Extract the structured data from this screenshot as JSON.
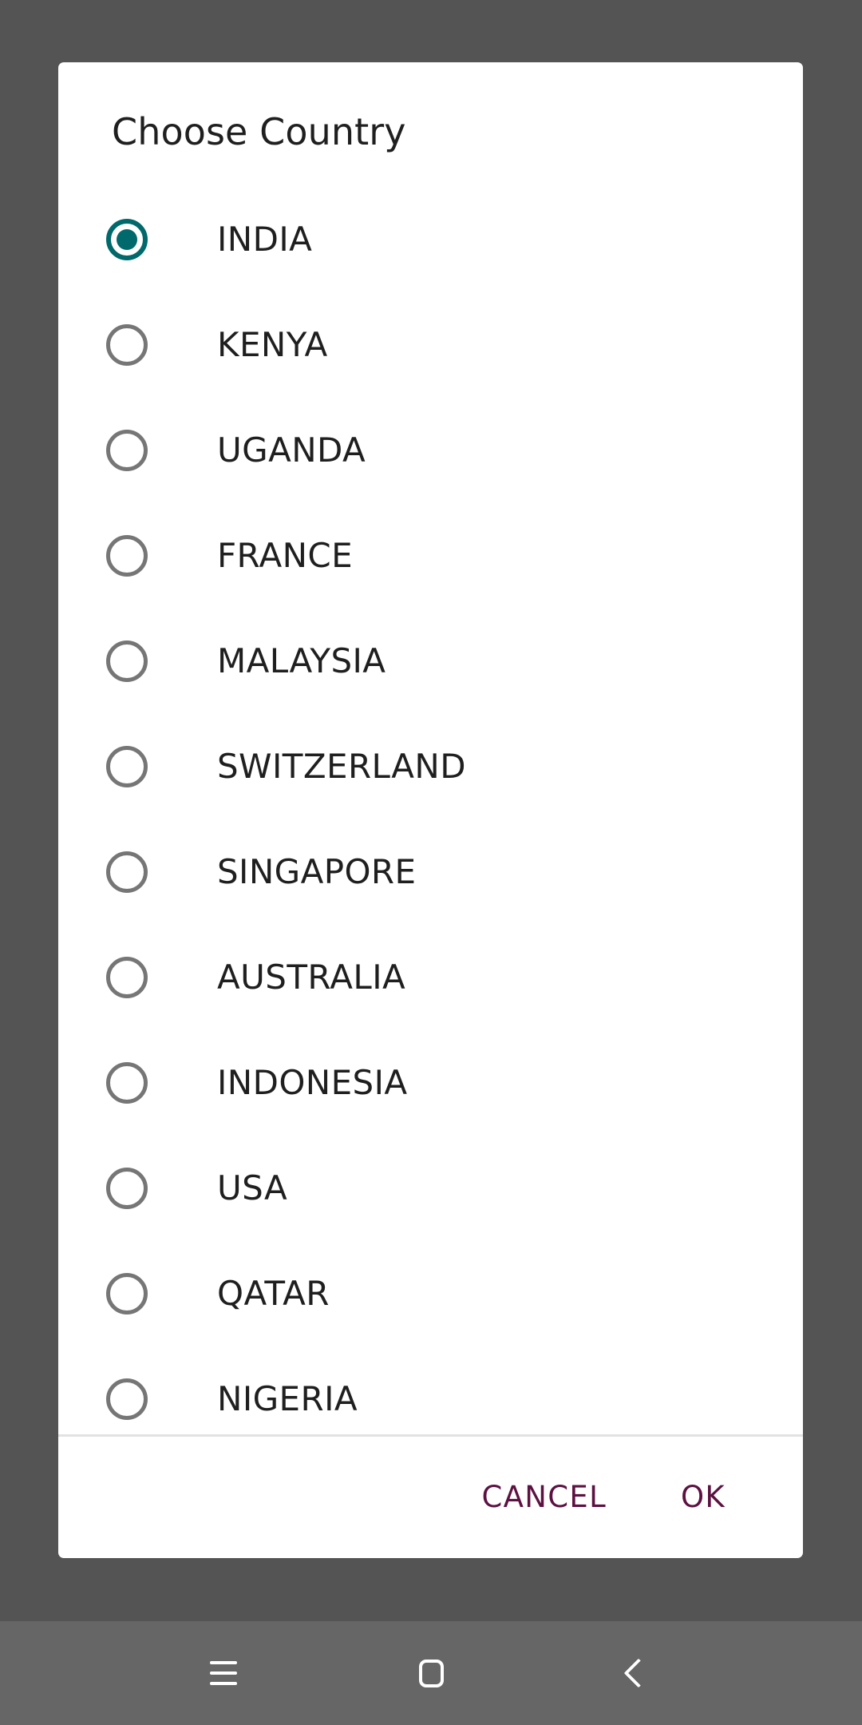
{
  "dialog": {
    "title": "Choose Country",
    "options": [
      {
        "label": "INDIA",
        "selected": true
      },
      {
        "label": "KENYA",
        "selected": false
      },
      {
        "label": "UGANDA",
        "selected": false
      },
      {
        "label": "FRANCE",
        "selected": false
      },
      {
        "label": "MALAYSIA",
        "selected": false
      },
      {
        "label": "SWITZERLAND",
        "selected": false
      },
      {
        "label": "SINGAPORE",
        "selected": false
      },
      {
        "label": "AUSTRALIA",
        "selected": false
      },
      {
        "label": "INDONESIA",
        "selected": false
      },
      {
        "label": "USA",
        "selected": false
      },
      {
        "label": "QATAR",
        "selected": false
      },
      {
        "label": "NIGERIA",
        "selected": false
      }
    ],
    "selected_value": "INDIA",
    "actions": {
      "cancel_label": "CANCEL",
      "ok_label": "OK"
    }
  },
  "navbar": {
    "recents_icon": "hamburger-icon",
    "home_icon": "home-square-icon",
    "back_icon": "chevron-left-icon"
  },
  "colors": {
    "accent_teal": "#00696B",
    "action_purple": "#5C1141",
    "scrim": "#545454",
    "navbar": "#666666",
    "dialog_bg": "#FFFFFF",
    "divider": "#E2E2E2",
    "radio_unselected": "#767676",
    "text_primary": "#1F1F1F"
  }
}
